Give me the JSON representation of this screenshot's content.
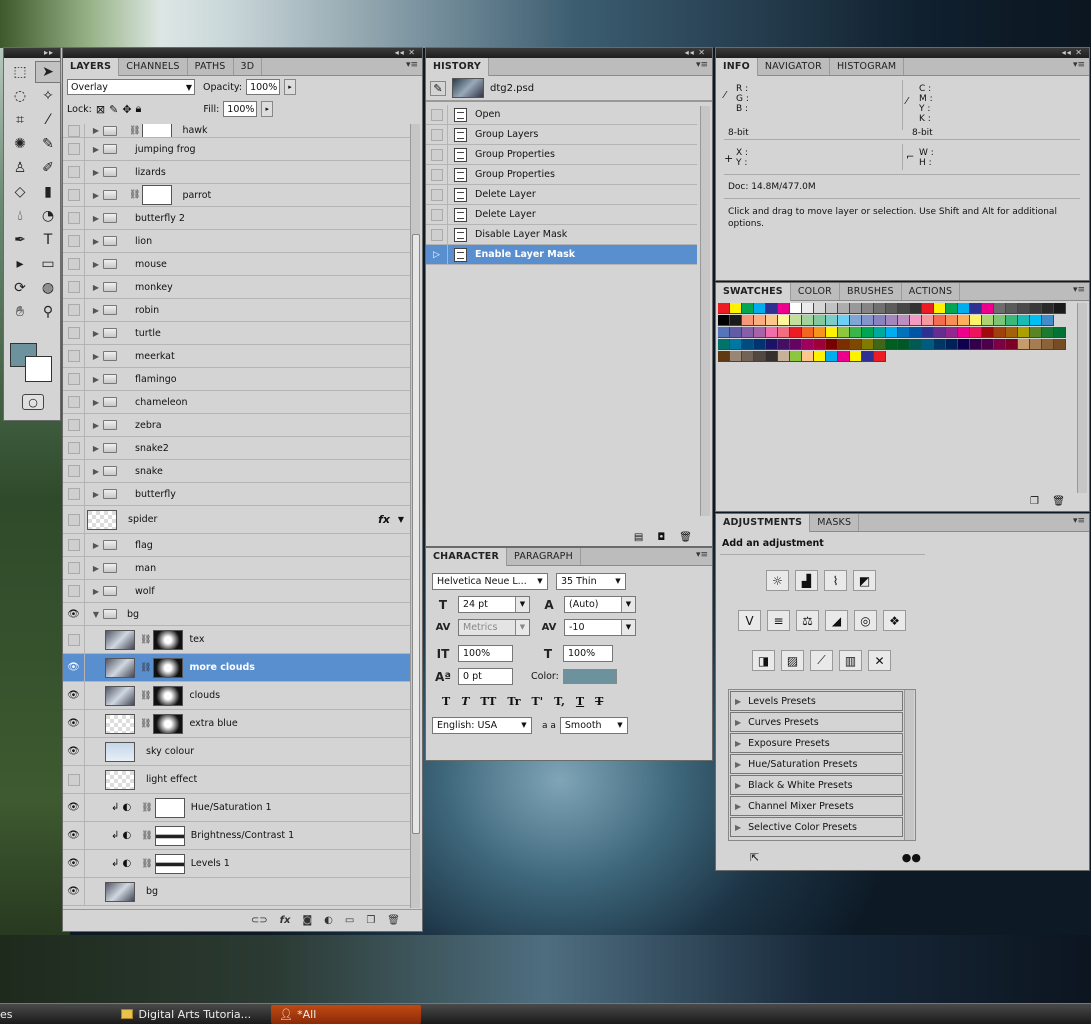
{
  "toolbox": {
    "tools": [
      "marquee-icon",
      "move-icon",
      "lasso-icon",
      "magic-wand-icon",
      "crop-icon",
      "eyedropper-icon",
      "spot-heal-icon",
      "brush-icon",
      "stamp-icon",
      "history-brush-icon",
      "eraser-icon",
      "gradient-icon",
      "blur-icon",
      "dodge-icon",
      "pen-icon",
      "type-icon",
      "path-select-icon",
      "shape-icon",
      "rotate-3d-icon",
      "orbit-3d-icon",
      "hand-icon",
      "zoom-icon"
    ],
    "fg_color": "#6c929d",
    "bg_color": "#ffffff"
  },
  "layers": {
    "tabs": [
      "LAYERS",
      "CHANNELS",
      "PATHS",
      "3D"
    ],
    "blend_mode": "Overlay",
    "opacity_label": "Opacity:",
    "opacity": "100%",
    "lock_label": "Lock:",
    "fill_label": "Fill:",
    "fill": "100%",
    "rows": [
      {
        "name": "hawk",
        "type": "group",
        "mask": true
      },
      {
        "name": "jumping frog",
        "type": "group"
      },
      {
        "name": "lizards",
        "type": "group"
      },
      {
        "name": "parrot",
        "type": "group",
        "mask": true
      },
      {
        "name": "butterfly 2",
        "type": "group"
      },
      {
        "name": "lion",
        "type": "group"
      },
      {
        "name": "mouse",
        "type": "group"
      },
      {
        "name": "monkey",
        "type": "group"
      },
      {
        "name": "robin",
        "type": "group"
      },
      {
        "name": "turtle",
        "type": "group"
      },
      {
        "name": "meerkat",
        "type": "group"
      },
      {
        "name": "flamingo",
        "type": "group"
      },
      {
        "name": "chameleon",
        "type": "group"
      },
      {
        "name": "zebra",
        "type": "group"
      },
      {
        "name": "snake2",
        "type": "group"
      },
      {
        "name": "snake",
        "type": "group"
      },
      {
        "name": "butterfly",
        "type": "group"
      },
      {
        "name": "spider",
        "type": "layer",
        "fx": "fx"
      },
      {
        "name": "flag",
        "type": "group"
      },
      {
        "name": "man",
        "type": "group"
      },
      {
        "name": "wolf",
        "type": "group"
      },
      {
        "name": "bg",
        "type": "group-open",
        "eye": true
      },
      {
        "name": "tex",
        "type": "layer",
        "mask": true
      },
      {
        "name": "more clouds",
        "type": "layer",
        "mask": true,
        "eye": true,
        "selected": true
      },
      {
        "name": "clouds",
        "type": "layer",
        "mask": true,
        "eye": true
      },
      {
        "name": "extra blue",
        "type": "layer",
        "mask": true,
        "eye": true
      },
      {
        "name": "sky colour",
        "type": "layer",
        "eye": true
      },
      {
        "name": "light effect",
        "type": "layer"
      },
      {
        "name": "Hue/Saturation 1",
        "type": "adj",
        "eye": true
      },
      {
        "name": "Brightness/Contrast 1",
        "type": "adj",
        "eye": true
      },
      {
        "name": "Levels 1",
        "type": "adj",
        "eye": true
      },
      {
        "name": "bg",
        "type": "layer",
        "eye": true
      }
    ]
  },
  "history": {
    "tab": "HISTORY",
    "snapshot": "dtg2.psd",
    "items": [
      "Open",
      "Group Layers",
      "Group Properties",
      "Group Properties",
      "Delete Layer",
      "Delete Layer",
      "Disable Layer Mask",
      "Enable Layer Mask"
    ],
    "selected_index": 7
  },
  "character": {
    "tabs": [
      "CHARACTER",
      "PARAGRAPH"
    ],
    "font_family": "Helvetica Neue L...",
    "font_style": "35 Thin",
    "font_size": "24 pt",
    "leading": "(Auto)",
    "kerning": "Metrics",
    "tracking": "-10",
    "vscale": "100%",
    "hscale": "100%",
    "baseline": "0 pt",
    "color_label": "Color:",
    "color": "#6c929d",
    "language": "English: USA",
    "aa_label": "a a",
    "antialias": "Smooth",
    "type_buttons": [
      "T",
      "T",
      "TT",
      "Tr",
      "T'",
      "T,",
      "T",
      "T"
    ]
  },
  "info": {
    "tabs": [
      "INFO",
      "NAVIGATOR",
      "HISTOGRAM"
    ],
    "rgb_labels": [
      "R :",
      "G :",
      "B :"
    ],
    "cmyk_labels": [
      "C :",
      "M :",
      "Y :",
      "K :"
    ],
    "bit_left": "8-bit",
    "bit_right": "8-bit",
    "xy_labels": [
      "X :",
      "Y :"
    ],
    "wh_labels": [
      "W :",
      "H :"
    ],
    "doc": "Doc: 14.8M/477.0M",
    "hint": "Click and drag to move layer or selection.  Use Shift and Alt for additional options."
  },
  "swatches": {
    "tabs": [
      "SWATCHES",
      "COLOR",
      "BRUSHES",
      "ACTIONS"
    ],
    "rows": [
      [
        "#ed1c24",
        "#fff200",
        "#00a651",
        "#00aeef",
        "#2e3192",
        "#ec008c",
        "#ffffff",
        "#ebebeb",
        "#d6d6d6",
        "#c2c2c2",
        "#adadad",
        "#999999",
        "#858585",
        "#707070",
        "#5c5c5c",
        "#474747",
        "#333333",
        "#ed1c24",
        "#fff200",
        "#00a651",
        "#00aeef",
        "#2e3192",
        "#ec008c",
        "#6d6d6d",
        "#5a5a5a",
        "#4a4a4a",
        "#3a3a3a",
        "#2a2a2a",
        "#1a1a1a"
      ],
      [
        "#000000",
        "#1a1a1a",
        "#f7977a",
        "#f9ad81",
        "#fdc68a",
        "#fff79a",
        "#c4df9b",
        "#a2d39c",
        "#82ca9d",
        "#7bcdc8",
        "#6ecff6",
        "#7ea7d8",
        "#8493ca",
        "#8882be",
        "#a187be",
        "#bc8dbf",
        "#f49ac2",
        "#f6989d",
        "#f26c4f",
        "#f68e55",
        "#fbaf5c",
        "#fff467",
        "#acd372",
        "#7cc576",
        "#3bb878",
        "#1abbb4",
        "#00bff3",
        "#438ccb"
      ],
      [
        "#5574b9",
        "#605ca8",
        "#855fa8",
        "#a763a8",
        "#f06eaa",
        "#f26d7d",
        "#ed1c24",
        "#f26522",
        "#f7941d",
        "#fff200",
        "#8dc63f",
        "#39b54a",
        "#00a651",
        "#00a99d",
        "#00aeef",
        "#0072bc",
        "#0054a6",
        "#2e3192",
        "#662d91",
        "#92278f",
        "#ec008c",
        "#ed145b",
        "#9e0b0f",
        "#a0410d",
        "#a36209",
        "#aba000",
        "#598527",
        "#1a7b30",
        "#007236"
      ],
      [
        "#00746b",
        "#0076a3",
        "#004b80",
        "#003471",
        "#1b1464",
        "#440e62",
        "#630460",
        "#9e005d",
        "#9e0039",
        "#790000",
        "#7b2e00",
        "#7d4900",
        "#827b00",
        "#406618",
        "#005e20",
        "#005826",
        "#005952",
        "#005b7f",
        "#003663",
        "#002157",
        "#0d004c",
        "#32004b",
        "#4b0049",
        "#7b0046",
        "#7a0026",
        "#c69c6d",
        "#a67c52",
        "#8c6239",
        "#754c24"
      ],
      [
        "#603913",
        "#998675",
        "#736357",
        "#534741",
        "#362f2d",
        "#c7b299",
        "#8dc63f",
        "#fdc68a",
        "#fff200",
        "#00aeef",
        "#ec008c",
        "#fff200",
        "#2e3192",
        "#ed1c24"
      ]
    ]
  },
  "adjustments": {
    "tabs": [
      "ADJUSTMENTS",
      "MASKS"
    ],
    "heading": "Add an adjustment",
    "presets": [
      "Levels Presets",
      "Curves Presets",
      "Exposure Presets",
      "Hue/Saturation Presets",
      "Black & White Presets",
      "Channel Mixer Presets",
      "Selective Color Presets"
    ]
  },
  "taskbar": {
    "items": [
      "es",
      "Digital Arts Tutoria...",
      "*All"
    ]
  }
}
